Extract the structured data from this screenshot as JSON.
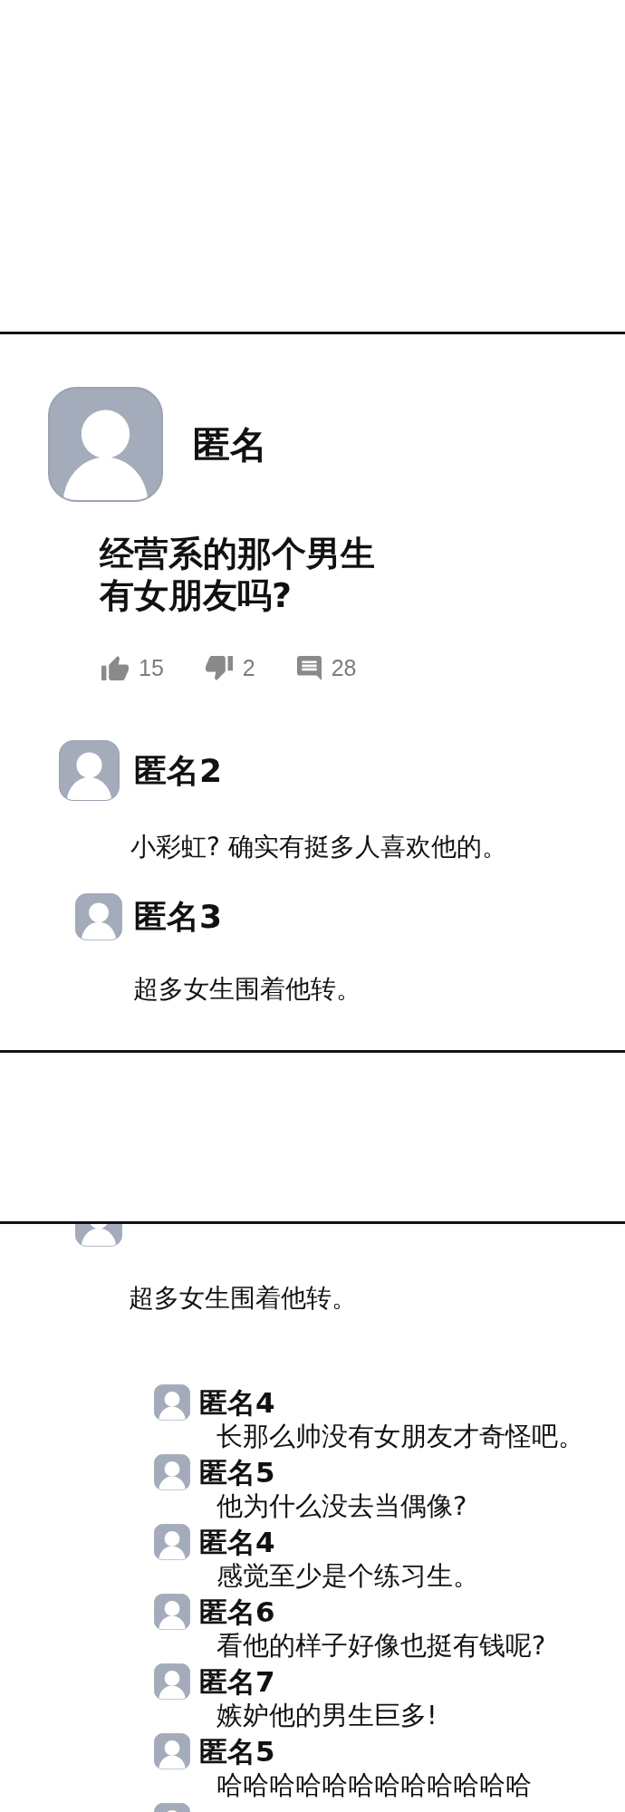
{
  "post": {
    "author": "匿名",
    "title_lines": [
      "经营系的那个男生",
      "有女朋友吗?"
    ],
    "stats": [
      {
        "kind": "like",
        "count": "15"
      },
      {
        "kind": "dislike",
        "count": "2"
      },
      {
        "kind": "comment",
        "count": "28"
      }
    ]
  },
  "comments": [
    {
      "author": "匿名2",
      "text": "小彩虹? 确实有挺多人喜欢他的。"
    },
    {
      "author": "匿名3",
      "text": "超多女生围着他转。"
    }
  ],
  "panel_2": {
    "continued_comment_text": "超多女生围着他转。",
    "replies": [
      {
        "author": "匿名4",
        "text": "长那么帅没有女朋友才奇怪吧。"
      },
      {
        "author": "匿名5",
        "text": "他为什么没去当偶像?"
      },
      {
        "author": "匿名4",
        "text": "感觉至少是个练习生。"
      },
      {
        "author": "匿名6",
        "text": "看他的样子好像也挺有钱呢?"
      },
      {
        "author": "匿名7",
        "text": "嫉妒他的男生巨多!"
      },
      {
        "author": "匿名5",
        "text": "哈哈哈哈哈哈哈哈哈哈哈哈"
      }
    ]
  }
}
